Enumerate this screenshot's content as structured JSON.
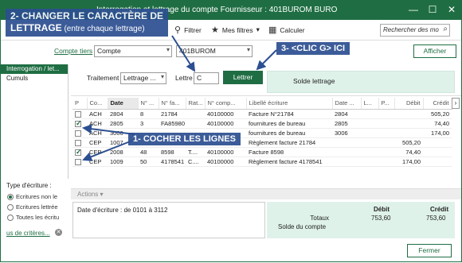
{
  "window": {
    "title": "Interrogation et lettrage du compte Fournisseur : 401BUROM BURO",
    "minimize": "—",
    "maximize": "☐",
    "close": "✕"
  },
  "toolbar": {
    "filter_label": "Filtrer",
    "myfilters_label": "Mes filtres",
    "calc_label": "Calculer",
    "search_placeholder": "Rechercher des mo"
  },
  "header": {
    "compte_tiers_link": "Compte tiers",
    "compte_select": "Compte",
    "compte_value": "401BUROM",
    "afficher_label": "Afficher"
  },
  "sidebar": {
    "items": [
      {
        "label": "Interrogation / let..."
      },
      {
        "label": "Cumuls"
      }
    ],
    "type_ecriture_label": "Type d'écriture :",
    "radios": [
      {
        "label": "Ecritures non le",
        "checked": true
      },
      {
        "label": "Ecritures lettrée",
        "checked": false
      },
      {
        "label": "Toutes les écritu",
        "checked": false
      }
    ],
    "criteres_link": "us de critères..."
  },
  "lettrage": {
    "traitement_label": "Traitement",
    "traitement_value": "Lettrage ...",
    "lettre_label": "Lettre",
    "lettre_value": "C",
    "lettrer_button": "Lettrer",
    "solde_label": "Solde lettrage"
  },
  "table": {
    "columns": [
      "P",
      "Co...",
      "Date",
      "N° ...",
      "N° fa...",
      "Rat...",
      "N° comp...",
      "Libellé écriture",
      "Date ...",
      "L...",
      "P...",
      "Débit",
      "Crédit"
    ],
    "rows": [
      {
        "checked": false,
        "code": "ACH",
        "date": "2804",
        "num": "8",
        "fact": "21784",
        "rat": "",
        "compte": "40100000",
        "libelle": "Facture N°21784",
        "date2": "2804",
        "debit": "",
        "credit": "505,20"
      },
      {
        "checked": true,
        "code": "ACH",
        "date": "2805",
        "num": "3",
        "fact": "FA85980",
        "rat": "",
        "compte": "40100000",
        "libelle": "fournitures de bureau",
        "date2": "2805",
        "debit": "",
        "credit": "74,40"
      },
      {
        "checked": false,
        "code": "ACH",
        "date": "3006",
        "num": "",
        "fact": "",
        "rat": "",
        "compte": "",
        "libelle": "fournitures de bureau",
        "date2": "3006",
        "debit": "",
        "credit": "174,00"
      },
      {
        "checked": false,
        "code": "CEP",
        "date": "1007",
        "num": "",
        "fact": "",
        "rat": "",
        "compte": "",
        "libelle": "Règlement facture 21784",
        "date2": "",
        "debit": "505,20",
        "credit": ""
      },
      {
        "checked": true,
        "code": "CEP",
        "date": "2008",
        "num": "48",
        "fact": "8598",
        "rat": "T....",
        "compte": "40100000",
        "libelle": "Facture 8598",
        "date2": "",
        "debit": "74,40",
        "credit": ""
      },
      {
        "checked": false,
        "code": "CEP",
        "date": "1009",
        "num": "50",
        "fact": "4178541",
        "rat": "C....",
        "compte": "40100000",
        "libelle": "Règlement facture 4178541",
        "date2": "",
        "debit": "174,00",
        "credit": ""
      }
    ]
  },
  "actions_label": "Actions ▾",
  "footer": {
    "date_range": "Date d'écriture : de 0101  à 3112",
    "debit_header": "Débit",
    "credit_header": "Crédit",
    "totaux_label": "Totaux",
    "totaux_debit": "753,60",
    "totaux_credit": "753,60",
    "solde_compte_label": "Solde du compte"
  },
  "fermer_label": "Fermer",
  "annotations": {
    "note1_line1": "2- CHANGER LE CARACTÈRE DE",
    "note1_line2_bold": "LETTRAGE",
    "note1_line2_rest": " (entre chaque lettrage)",
    "note2": "3- <CLIC G> ICI",
    "note3": "1- COCHER LES LIGNES"
  },
  "colors": {
    "accent": "#1f6e43",
    "solde_bg": "#dff2ea",
    "annotation": "#2c4f91"
  }
}
